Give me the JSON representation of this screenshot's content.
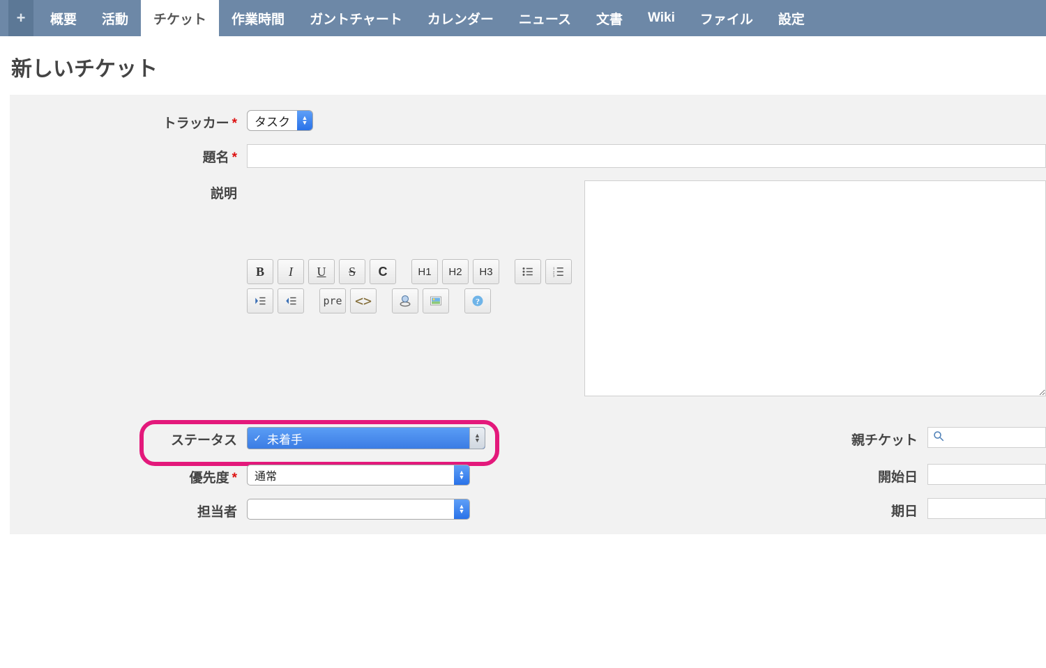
{
  "tabs": {
    "plus": "+",
    "items": [
      "概要",
      "活動",
      "チケット",
      "作業時間",
      "ガントチャート",
      "カレンダー",
      "ニュース",
      "文書",
      "Wiki",
      "ファイル",
      "設定"
    ],
    "active_index": 2
  },
  "page_title": "新しいチケット",
  "fields": {
    "tracker": {
      "label": "トラッカー",
      "required": true,
      "value": "タスク"
    },
    "subject": {
      "label": "題名",
      "required": true,
      "value": ""
    },
    "description": {
      "label": "説明"
    },
    "status": {
      "label": "ステータス",
      "selected": "未着手"
    },
    "priority": {
      "label": "優先度",
      "required": true,
      "value": "通常"
    },
    "assignee": {
      "label": "担当者",
      "value": ""
    },
    "parent": {
      "label": "親チケット"
    },
    "start_date": {
      "label": "開始日"
    },
    "due_date": {
      "label": "期日"
    }
  },
  "toolbar": {
    "bold": "B",
    "italic": "I",
    "underline": "U",
    "strike": "S",
    "c": "C",
    "h1": "H1",
    "h2": "H2",
    "h3": "H3",
    "pre": "pre",
    "code": "<>",
    "help": "?"
  },
  "required_mark": "*",
  "check_mark": "✓"
}
